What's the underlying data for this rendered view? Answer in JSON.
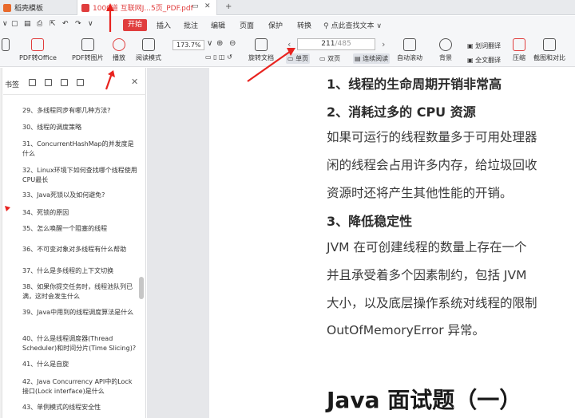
{
  "tabs": [
    {
      "label": "稻壳模板"
    },
    {
      "label": "1000道 互联网J...5页_PDF.pdf"
    }
  ],
  "menu": {
    "start": "开始",
    "items": [
      "插入",
      "批注",
      "编辑",
      "页面",
      "保护",
      "转换"
    ],
    "search": "点此查找文本"
  },
  "toolbar": {
    "pdf_to_office": "PDF转Office",
    "pdf_to_image": "PDF转图片",
    "play": "播放",
    "read_mode": "阅读模式",
    "zoom": "173.7%",
    "rotate": "旋转文档",
    "page_current": "211",
    "page_total": "/485",
    "single_page": "单页",
    "double_page": "双页",
    "continuous": "连续阅读",
    "auto_scroll": "自动滚动",
    "background": "背景",
    "word_translate": "划词翻译",
    "full_translate": "全文翻译",
    "compress": "压缩",
    "screenshot_compare": "截图和对比"
  },
  "panel": {
    "title": "书签",
    "bookmarks": [
      "29、多线程同步有哪几种方法?",
      "30、线程的调度策略",
      "31、ConcurrentHashMap的并发度是什么",
      "32、Linux环境下如何查找哪个线程使用CPU最长",
      "33、Java死锁以及如何避免?",
      "34、死锁的原因",
      "35、怎么唤醒一个阻塞的线程",
      "36、不可变对象对多线程有什么帮助",
      "37、什么是多线程的上下文切换",
      "38、如果你提交任务时，线程池队列已满，这时会发生什么",
      "39、Java中用到的线程调度算法是什么",
      "40、什么是线程调度器(Thread Scheduler)和时间分片(Time Slicing)?",
      "41、什么是自旋",
      "42、Java Concurrency API中的Lock接口(Lock interface)是什么",
      "43、单例模式的线程安全性"
    ]
  },
  "document": {
    "heading1": "1、线程的生命周期开销非常高",
    "heading2": "2、消耗过多的 CPU 资源",
    "para1": [
      "如果可运行的线程数量多于可用处理器",
      "闲的线程会占用许多内存，给垃圾回收",
      "资源时还将产生其他性能的开销。"
    ],
    "heading3": "3、降低稳定性",
    "para2": [
      "JVM 在可创建线程的数量上存在一个",
      "并且承受着多个因素制约，包括 JVM",
      "大小，以及底层操作系统对线程的限制",
      "OutOfMemoryError 异常。"
    ],
    "title": "Java  面试题（一）"
  },
  "colors": {
    "accent": "#e03d3d",
    "annotation_arrow": "#e8231f"
  }
}
